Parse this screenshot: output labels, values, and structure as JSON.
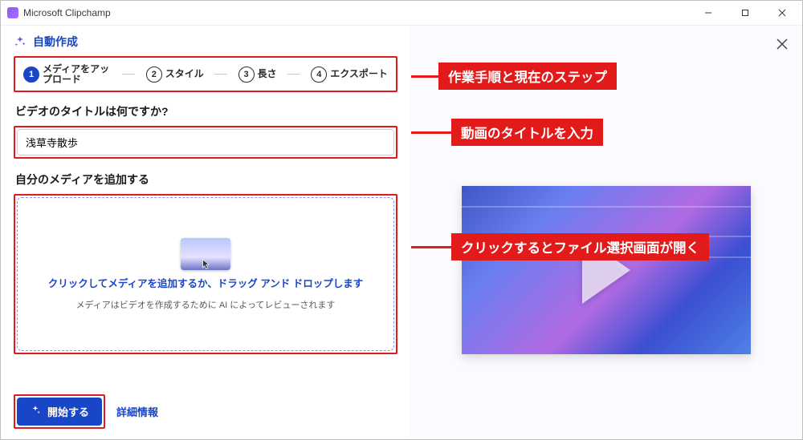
{
  "app": {
    "title": "Microsoft Clipchamp"
  },
  "auto_create_header": "自動作成",
  "steps": {
    "s1": "メディアをアップロード",
    "s2": "スタイル",
    "s3": "長さ",
    "s4": "エクスポート"
  },
  "question": "ビデオのタイトルは何ですか?",
  "title_field": {
    "value": "浅草寺散歩"
  },
  "add_media_label": "自分のメディアを追加する",
  "drop": {
    "main": "クリックしてメディアを追加するか、ドラッグ アンド ドロップします",
    "sub": "メディアはビデオを作成するために AI によってレビューされます"
  },
  "footer": {
    "start": "開始する",
    "details": "詳細情報"
  },
  "annotations": {
    "steps": "作業手順と現在のステップ",
    "title": "動画のタイトルを入力",
    "drop": "クリックするとファイル選択画面が開く"
  }
}
